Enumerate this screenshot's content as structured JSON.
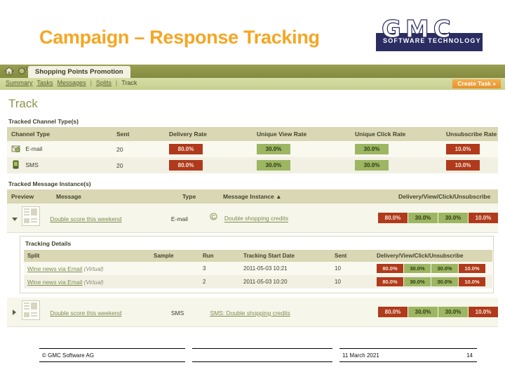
{
  "slide": {
    "title": "Campaign – Response Tracking"
  },
  "logo": {
    "letters": "GMC",
    "subtitle": "SOFTWARE TECHNOLOGY"
  },
  "app": {
    "toolbar": {
      "home_icon": "home-icon",
      "campaign_icon": "campaign-icon",
      "active_tab": "Shopping Points Promotion"
    },
    "nav": {
      "items": [
        {
          "label": "Summary",
          "current": false
        },
        {
          "label": "Tasks",
          "current": false
        },
        {
          "label": "Messages",
          "current": false
        },
        {
          "label": "Splits",
          "current": false
        },
        {
          "label": "Track",
          "current": true
        }
      ],
      "separator": "|",
      "create_task_label": "Create Task »"
    },
    "page_title": "Track",
    "channel_section": {
      "label": "Tracked Channel Type(s)",
      "columns": [
        "Channel Type",
        "Sent",
        "Delivery Rate",
        "Unique View Rate",
        "Unique Click Rate",
        "Unsubscribe Rate"
      ],
      "rows": [
        {
          "icon": "email-icon",
          "channel": "E-mail",
          "sent": "20",
          "delivery_rate": "80.0%",
          "unique_view_rate": "30.0%",
          "unique_click_rate": "30.0%",
          "unsubscribe_rate": "10.0%"
        },
        {
          "icon": "sms-icon",
          "channel": "SMS",
          "sent": "20",
          "delivery_rate": "80.0%",
          "unique_view_rate": "30.0%",
          "unique_click_rate": "30.0%",
          "unsubscribe_rate": "10.0%"
        }
      ]
    },
    "message_section": {
      "label": "Tracked Message Instance(s)",
      "columns": [
        "Preview",
        "Message",
        "Type",
        "Message Instance ▲",
        "Delivery/View/Click/Unsubscribe"
      ],
      "rows": [
        {
          "expanded": true,
          "expander_icon": "triangle-down-icon",
          "preview_icon": "document-preview-icon",
          "message": "Double score this weekend",
          "type": "E-mail",
          "instance_icon": "email-icon",
          "instance": "Double shopping credits",
          "stats": [
            "80.0%",
            "30.0%",
            "30.0%",
            "10.0%"
          ]
        },
        {
          "expanded": false,
          "expander_icon": "triangle-right-icon",
          "preview_icon": "document-preview-icon",
          "message": "Double score this weekend",
          "type": "SMS",
          "instance_icon": "sms-icon",
          "instance": "SMS: Double shopping credits",
          "stats": [
            "80.0%",
            "30.0%",
            "30.0%",
            "10.0%"
          ]
        }
      ],
      "details": {
        "title": "Tracking Details",
        "columns": [
          "Split",
          "Sample",
          "Run",
          "Tracking Start Date",
          "Sent",
          "Delivery/View/Click/Unsubscribe"
        ],
        "rows": [
          {
            "split": "Wine news via Email",
            "split_note": "(Virtual)",
            "sample": "",
            "run": "3",
            "start_date": "2011-05-03 10:21",
            "sent": "10",
            "stats": [
              "80.0%",
              "30.0%",
              "30.0%",
              "10.0%"
            ]
          },
          {
            "split": "Wine news via Email",
            "split_note": "(Virtual)",
            "sample": "",
            "run": "2",
            "start_date": "2011-05-03 10:20",
            "sent": "10",
            "stats": [
              "80.0%",
              "30.0%",
              "30.0%",
              "10.0%"
            ]
          }
        ]
      }
    }
  },
  "footer": {
    "copyright": "© GMC Software AG",
    "middle": "",
    "date": "11 March 2021",
    "page_number": "14"
  },
  "colors": {
    "title_orange": "#f5a623",
    "nav_green": "#8f9447",
    "nav_light_green": "#cfd79a",
    "badge_red": "#b03a1b",
    "badge_green": "#9cb661",
    "header_tan": "#d9d7b4",
    "logo_navy": "#2b2d62"
  }
}
